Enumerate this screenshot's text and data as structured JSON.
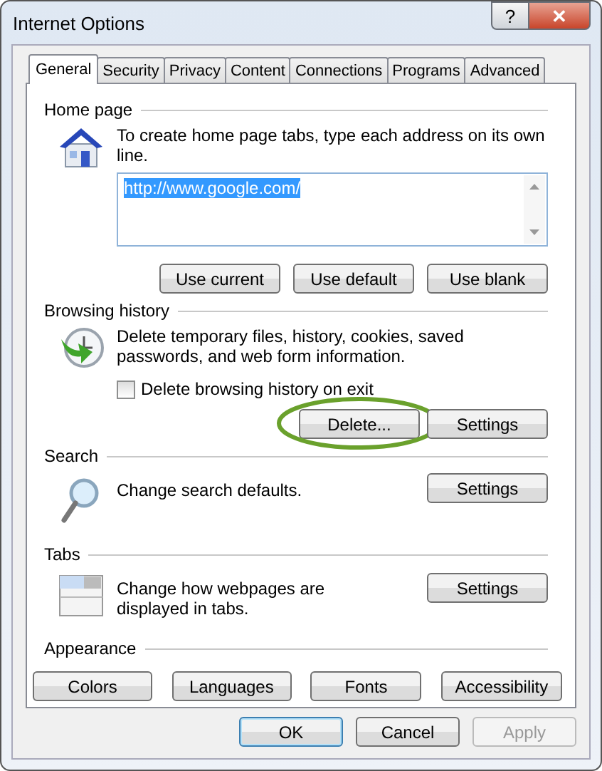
{
  "window": {
    "title": "Internet Options",
    "buttons": [
      "?",
      "✕"
    ]
  },
  "tabs": [
    {
      "label": "General",
      "selected": true
    },
    {
      "label": "Security",
      "selected": false
    },
    {
      "label": "Privacy",
      "selected": false
    },
    {
      "label": "Content",
      "selected": false
    },
    {
      "label": "Connections",
      "selected": false
    },
    {
      "label": "Programs",
      "selected": false
    },
    {
      "label": "Advanced",
      "selected": false
    }
  ],
  "home_page": {
    "title": "Home page",
    "text": "To create home page tabs, type each address on its own line.",
    "value": "http://www.google.com/",
    "buttons": [
      {
        "label": "Use current"
      },
      {
        "label": "Use default"
      },
      {
        "label": "Use blank"
      }
    ]
  },
  "browsing_history": {
    "title": "Browsing history",
    "text": "Delete temporary files, history, cookies, saved passwords, and web form information.",
    "checkbox": {
      "label": "Delete browsing history on exit",
      "checked": false
    },
    "buttons": [
      {
        "label": "Delete...",
        "circled": true
      },
      {
        "label": "Settings",
        "circled": false
      }
    ]
  },
  "search": {
    "title": "Search",
    "text": "Change search defaults.",
    "button": "Settings"
  },
  "tabs_section": {
    "title": "Tabs",
    "text": "Change how webpages are displayed in tabs.",
    "button": "Settings"
  },
  "appearance": {
    "title": "Appearance",
    "buttons": [
      "Colors",
      "Languages",
      "Fonts",
      "Accessibility"
    ]
  },
  "footer": [
    {
      "label": "OK",
      "default": true,
      "disabled": false
    },
    {
      "label": "Cancel",
      "default": false,
      "disabled": false
    },
    {
      "label": "Apply",
      "default": false,
      "disabled": true
    }
  ]
}
